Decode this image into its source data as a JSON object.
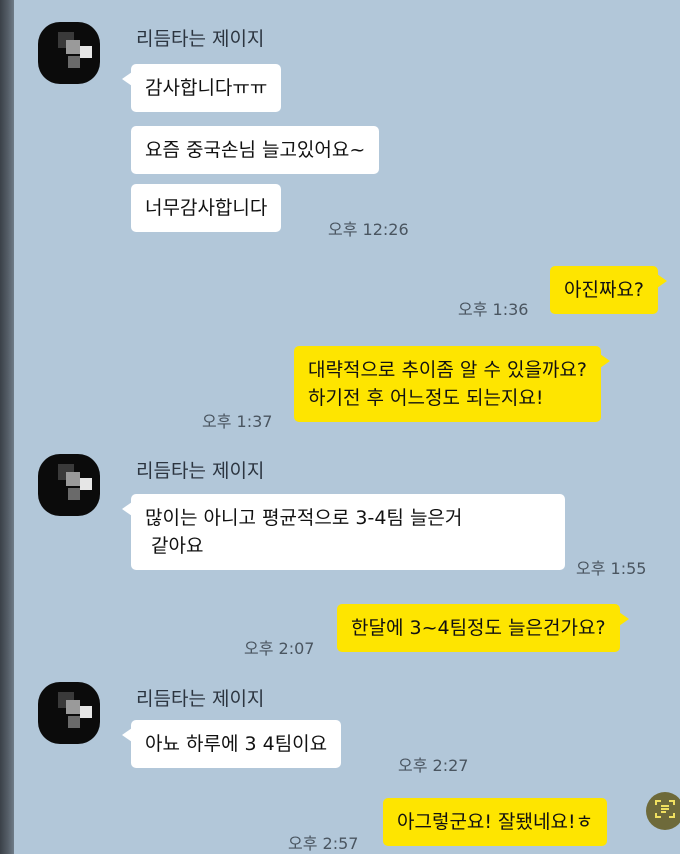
{
  "messages": [
    {
      "type": "in",
      "sender": "리듬타는 제이지",
      "bubbles": [
        "감사합니다ㅠㅠ",
        "요즘 중국손님 늘고있어요~",
        "너무감사합니다"
      ],
      "time": "오후 12:26"
    },
    {
      "type": "out",
      "lines": [
        "아진짜요?"
      ],
      "time": "오후 1:36"
    },
    {
      "type": "out",
      "lines": [
        "대략적으로 추이좀 알 수 있을까요?",
        "하기전 후 어느정도 되는지요!"
      ],
      "time": "오후 1:37"
    },
    {
      "type": "in",
      "sender": "리듬타는 제이지",
      "lines": [
        "많이는 아니고 평균적으로 3-4팀 늘은거",
        " 같아요"
      ],
      "time": "오후 1:55"
    },
    {
      "type": "out",
      "lines": [
        "한달에 3~4팀정도 늘은건가요?"
      ],
      "time": "오후 2:07"
    },
    {
      "type": "in",
      "sender": "리듬타는 제이지",
      "lines": [
        "아뇨 하루에 3 4팀이요"
      ],
      "time": "오후 2:27"
    },
    {
      "type": "out",
      "lines": [
        "아그렇군요! 잘됐네요!ㅎ"
      ],
      "time": "오후 2:57"
    }
  ],
  "colors": {
    "background": "#b2c7d9",
    "incoming_bubble": "#ffffff",
    "outgoing_bubble": "#fee500"
  },
  "icons": {
    "floating_button": "text-scan-icon"
  }
}
